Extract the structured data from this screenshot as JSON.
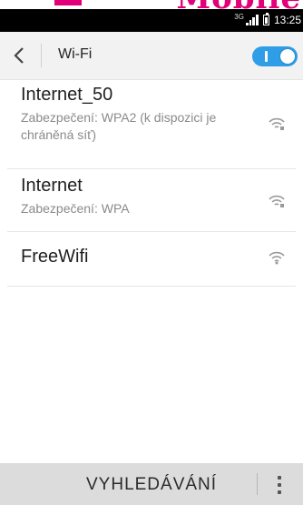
{
  "status_bar": {
    "network_type": "3G",
    "time": "13:25"
  },
  "header": {
    "title": "Wi-Fi",
    "wifi_enabled": true,
    "toggle_color": "#2f9ee6"
  },
  "networks": [
    {
      "name": "Internet_50",
      "security": "Zabezpečení: WPA2 (k dispozici je chráněná síť)",
      "icon": "wifi-secured-icon"
    },
    {
      "name": "Internet",
      "security": "Zabezpečení: WPA",
      "icon": "wifi-secured-icon"
    },
    {
      "name": "FreeWifi",
      "security": "",
      "icon": "wifi-open-icon"
    }
  ],
  "bottom_bar": {
    "scan_label": "VYHLEDÁVÁNÍ"
  },
  "colors": {
    "brand": "#e2007a"
  }
}
